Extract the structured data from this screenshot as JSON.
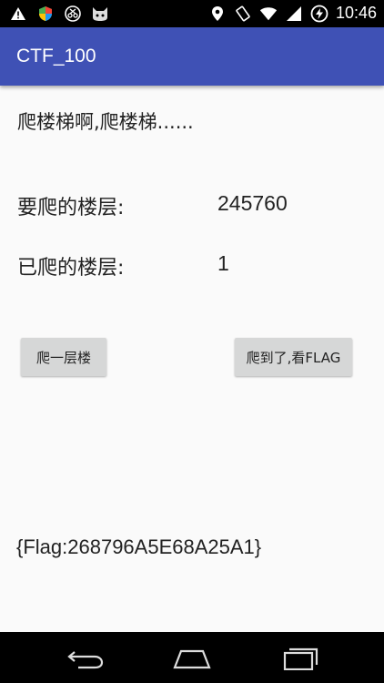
{
  "status_bar": {
    "time": "10:46",
    "left_icons": [
      "warning-icon",
      "shield-icon",
      "scissors-icon",
      "cat-icon"
    ],
    "right_icons": [
      "location-icon",
      "rotate-icon",
      "wifi-icon",
      "signal-icon",
      "battery-icon"
    ]
  },
  "app_bar": {
    "title": "CTF_100"
  },
  "main": {
    "headline": "爬楼梯啊,爬楼梯......",
    "target_label": "要爬的楼层:",
    "target_value": "245760",
    "climbed_label": "已爬的楼层:",
    "climbed_value": "1",
    "climb_button_label": "爬一层楼",
    "flag_button_label": "爬到了,看FLAG",
    "flag_text": "{Flag:268796A5E68A25A1}"
  },
  "nav_bar": {
    "icons": [
      "back-icon",
      "home-icon",
      "recents-icon"
    ]
  },
  "colors": {
    "app_bar": "#3f51b5",
    "button": "#d6d7d7",
    "background": "#fafafa"
  }
}
